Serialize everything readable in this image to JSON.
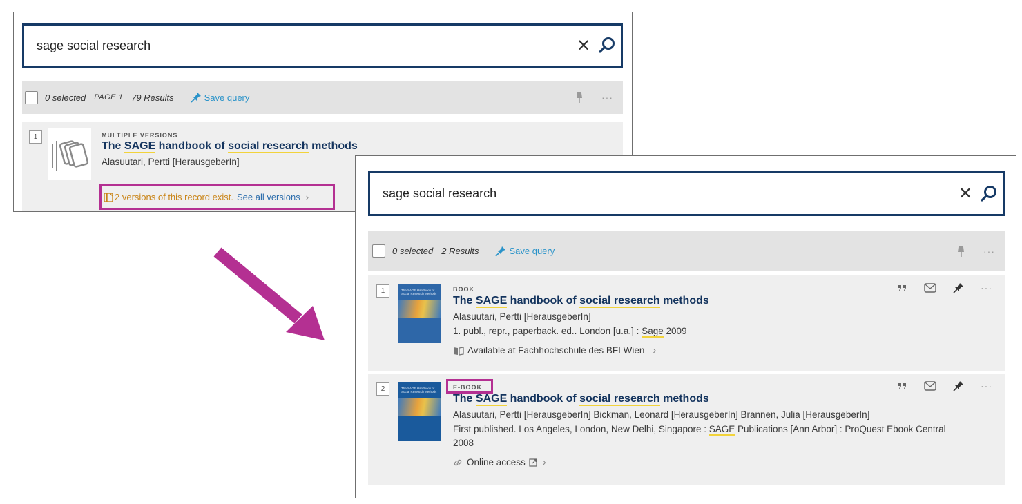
{
  "panel_a": {
    "search": {
      "query": "sage social research"
    },
    "toolbar": {
      "selected": "0 selected",
      "page": "PAGE 1",
      "results": "79 Results",
      "save_query": "Save query"
    },
    "record": {
      "number": "1",
      "type": "MULTIPLE VERSIONS",
      "title": {
        "pre": "The ",
        "h1": "SAGE",
        "mid": " handbook of ",
        "h2": "social research",
        "post": " methods"
      },
      "author": "Alasuutari, Pertti [HerausgeberIn]",
      "versions_text": "2 versions of this record exist.",
      "versions_link": "See all versions"
    }
  },
  "panel_b": {
    "search": {
      "query": "sage social research"
    },
    "toolbar": {
      "selected": "0 selected",
      "results": "2 Results",
      "save_query": "Save query"
    },
    "records": [
      {
        "number": "1",
        "type": "BOOK",
        "title": {
          "pre": "The ",
          "h1": "SAGE",
          "mid": " handbook of ",
          "h2": "social research",
          "post": " methods"
        },
        "line1": "Alasuutari, Pertti [HerausgeberIn]",
        "line2_pre": "1. publ., repr., paperback. ed.. London [u.a.] : ",
        "line2_hl": "Sage",
        "line2_post": " 2009",
        "availability": "Available at Fachhochschule des BFI Wien",
        "cover_title": "The SAGE Handbook of Social Research Methods"
      },
      {
        "number": "2",
        "type": "E-BOOK",
        "title": {
          "pre": "The ",
          "h1": "SAGE",
          "mid": " handbook of ",
          "h2": "social research",
          "post": " methods"
        },
        "line1": "Alasuutari, Pertti [HerausgeberIn] Bickman, Leonard [HerausgeberIn] Brannen, Julia [HerausgeberIn]",
        "line2_pre": "First published. Los Angeles, London, New Delhi, Singapore : ",
        "line2_hl": "SAGE",
        "line2_post": " Publications [Ann Arbor] : ProQuest Ebook Central",
        "line3": "2008",
        "availability": "Online access",
        "cover_title": "The SAGE Handbook of Social Research Methods"
      }
    ]
  },
  "colors": {
    "accent": "#14345e",
    "link": "#2a93c9",
    "highlight": "#f2d33b",
    "callout": "#b43092",
    "versions": "#c98417"
  },
  "icons": [
    "close-icon",
    "search-icon",
    "pin-icon",
    "more-icon",
    "citation-icon",
    "email-icon",
    "book-icon",
    "link-icon",
    "external-link-icon",
    "chevron-right-icon",
    "versions-icon"
  ]
}
